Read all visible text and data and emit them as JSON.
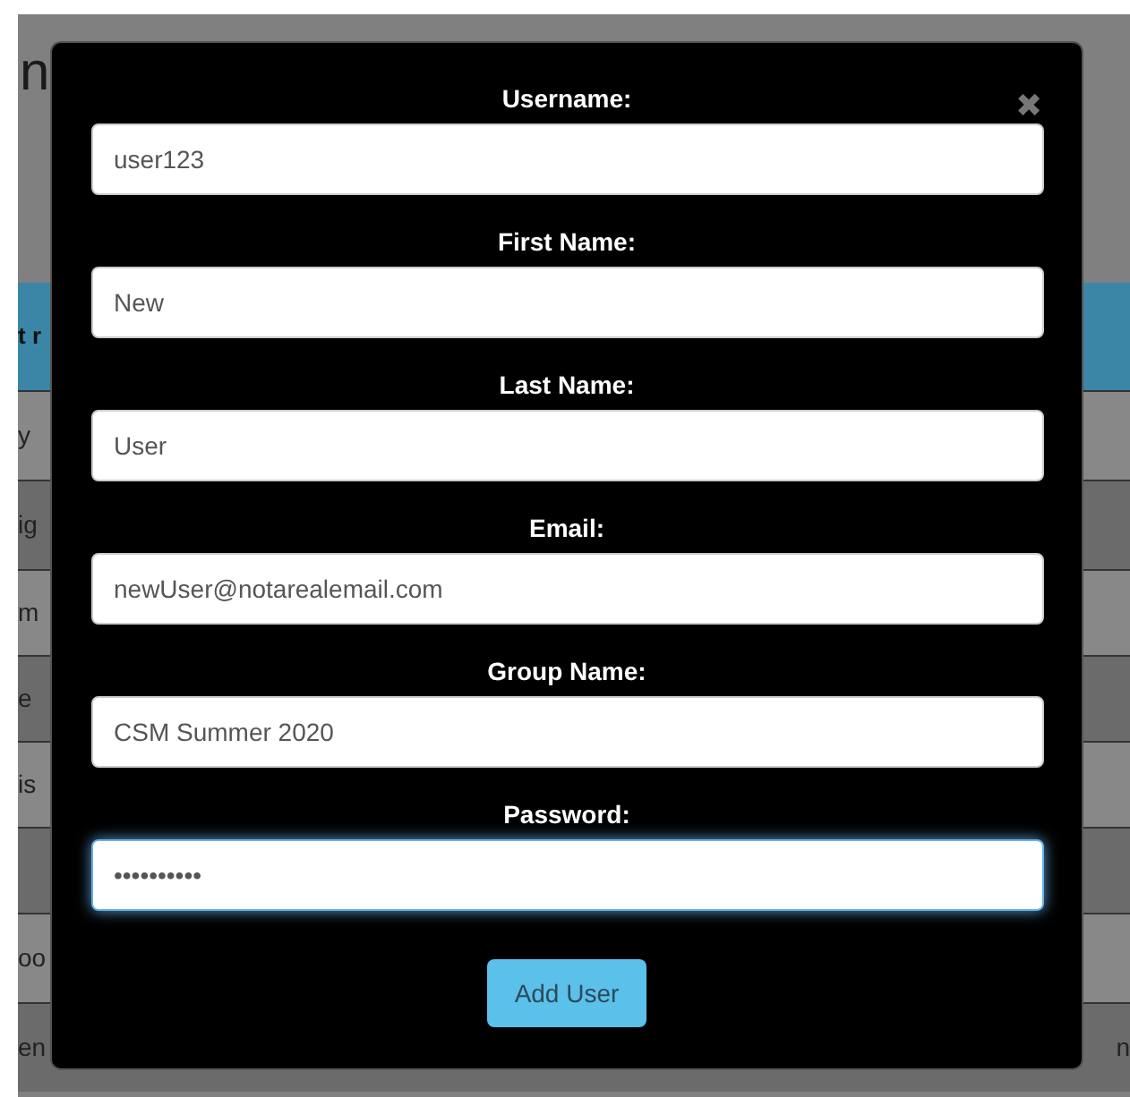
{
  "background_page": {
    "title": "n",
    "table_header": "t r",
    "rows": [
      {
        "column_1": "y"
      },
      {
        "column_1": "ig"
      },
      {
        "column_1": "m"
      },
      {
        "column_1": "e"
      },
      {
        "column_1": "is"
      },
      {},
      {
        "column_1": "oo"
      },
      {
        "column_1": "en",
        "column_last": "n"
      }
    ]
  },
  "dialog": {
    "close": "✖",
    "fields": [
      {
        "label": "Username:",
        "value": "user123",
        "focused": false
      },
      {
        "label": "First Name:",
        "value": "New",
        "focused": false
      },
      {
        "label": "Last Name:",
        "value": "User",
        "focused": false
      },
      {
        "label": "Email:",
        "value": "newUser@notarealemail.com",
        "focused": false
      },
      {
        "label": "Group Name:",
        "value": "CSM Summer 2020",
        "focused": false
      },
      {
        "label": "Password:",
        "value": "••••••••••",
        "focused": true
      }
    ],
    "submit": "Add User"
  }
}
